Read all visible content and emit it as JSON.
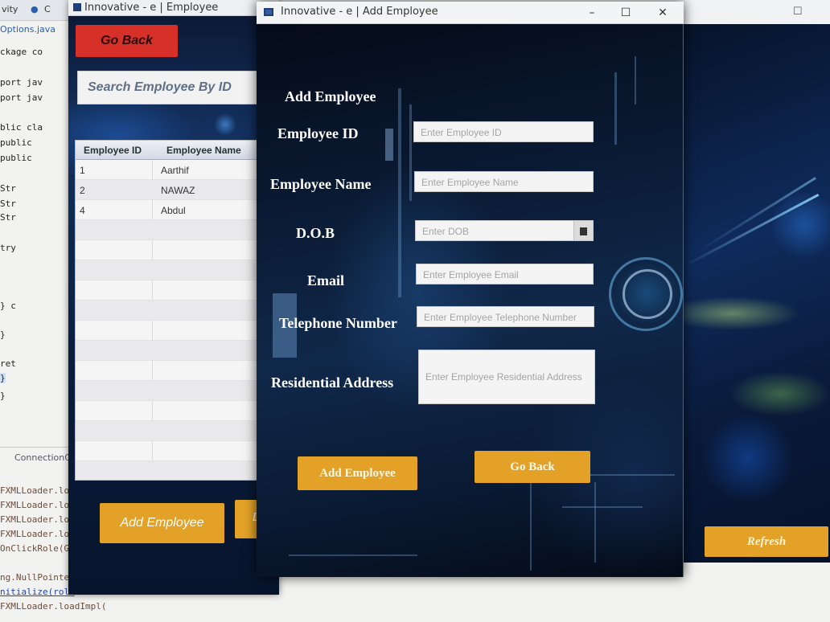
{
  "ide": {
    "tab_activity": "vity",
    "tab_class": "C",
    "file_tab": "Options.java",
    "code_lines": [
      "ckage co",
      "",
      "port jav",
      "port jav",
      "",
      "blic cla",
      "  public",
      "  public",
      "",
      "     Str",
      "     Str",
      "     Str",
      "",
      "     try",
      "",
      "",
      "",
      "",
      "     } c",
      "",
      "     }",
      "",
      "     ret",
      "  }",
      "}"
    ],
    "bottom_tab": "ConnectionCl",
    "console_lines": [
      "FXMLLoader.lo",
      "FXMLLoader.lo",
      "FXMLLoader.lo",
      "FXMLLoader.lo",
      "OnClickRole(G",
      "",
      "ng.NullPointe",
      "nitialize(role",
      "FXMLLoader.loadImpl("
    ]
  },
  "right_window": {
    "refresh_label": "Refresh"
  },
  "employee_window": {
    "title": "Innovative - e | Employee",
    "go_back_label": "Go Back",
    "search_placeholder": "Search Employee By ID",
    "columns": [
      "Employee ID",
      "Employee Name"
    ],
    "rows": [
      {
        "id": "1",
        "name": "Aarthif"
      },
      {
        "id": "2",
        "name": "NAWAZ"
      },
      {
        "id": "4",
        "name": "Abdul"
      }
    ],
    "add_employee_label": "Add Employee",
    "delete_label": "Del"
  },
  "add_window": {
    "title": "Innovative - e | Add Employee",
    "heading": "Add Employee",
    "labels": {
      "employee_id": "Employee ID",
      "employee_name": "Employee Name",
      "dob": "D.O.B",
      "email": "Email",
      "telephone": "Telephone Number",
      "address": "Residential Address"
    },
    "placeholders": {
      "employee_id": "Enter Employee ID",
      "employee_name": "Enter Employee Name",
      "dob": "Enter DOB",
      "email": "Enter Employee Email",
      "telephone": "Enter Employee Telephone Number",
      "address": "Enter Employee Residential Address"
    },
    "add_button": "Add Employee",
    "go_back_button": "Go Back",
    "controls": {
      "minimize": "–",
      "maximize": "☐",
      "close": "✕"
    }
  },
  "colors": {
    "accent_gold": "#e3a227",
    "go_back_red": "#d63029",
    "window_bg": "#071022"
  }
}
